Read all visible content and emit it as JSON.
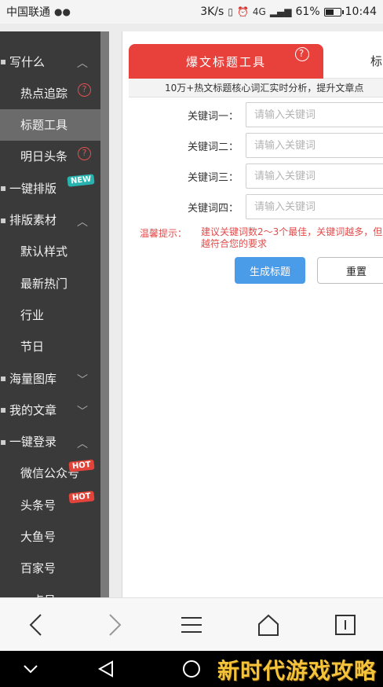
{
  "status_bar": {
    "carrier": "中国联通",
    "speed": "3K/s",
    "network": "4G",
    "battery": "61%",
    "battery_level": 0.61,
    "time": "10:44"
  },
  "sidebar": {
    "items": [
      {
        "label": "写什么",
        "type": "group",
        "chevron": "up"
      },
      {
        "label": "热点追踪",
        "type": "child",
        "help": true
      },
      {
        "label": "标题工具",
        "type": "child",
        "active": true
      },
      {
        "label": "明日头条",
        "type": "child",
        "help": true
      },
      {
        "label": "一键排版",
        "type": "group",
        "badge": "NEW"
      },
      {
        "label": "排版素材",
        "type": "group",
        "chevron": "up"
      },
      {
        "label": "默认样式",
        "type": "child"
      },
      {
        "label": "最新热门",
        "type": "child"
      },
      {
        "label": "行业",
        "type": "child"
      },
      {
        "label": "节日",
        "type": "child"
      },
      {
        "label": "海量图库",
        "type": "group",
        "chevron": "down"
      },
      {
        "label": "我的文章",
        "type": "group",
        "chevron": "down"
      },
      {
        "label": "一键登录",
        "type": "group",
        "chevron": "up"
      },
      {
        "label": "微信公众号",
        "type": "child",
        "badge": "HOT"
      },
      {
        "label": "头条号",
        "type": "child",
        "badge": "HOT"
      },
      {
        "label": "大鱼号",
        "type": "child"
      },
      {
        "label": "百家号",
        "type": "child"
      },
      {
        "label": "一点号",
        "type": "child"
      }
    ]
  },
  "main": {
    "tabs": [
      {
        "label": "爆文标题工具",
        "help": "?"
      },
      {
        "label": "标"
      }
    ],
    "subtitle": "10万+热文标题核心词汇实时分析，提升文章点",
    "fields": [
      {
        "label": "关键词一：",
        "placeholder": "请输入关键词"
      },
      {
        "label": "关键词二：",
        "placeholder": "请输入关键词"
      },
      {
        "label": "关键词三：",
        "placeholder": "请输入关键词"
      },
      {
        "label": "关键词四：",
        "placeholder": "请输入关键词"
      }
    ],
    "tip_label": "温馨提示：",
    "tip_text": "建议关键词数2～3个最佳，关键词越多，但越符合您的要求",
    "generate_label": "生成标题",
    "reset_label": "重置"
  },
  "watermark": "新时代游戏攻略",
  "colors": {
    "accent_red": "#e8413c",
    "button_blue": "#4a9be8",
    "sidebar_bg": "#3a3a3a",
    "tip_red": "#e34b4b"
  }
}
